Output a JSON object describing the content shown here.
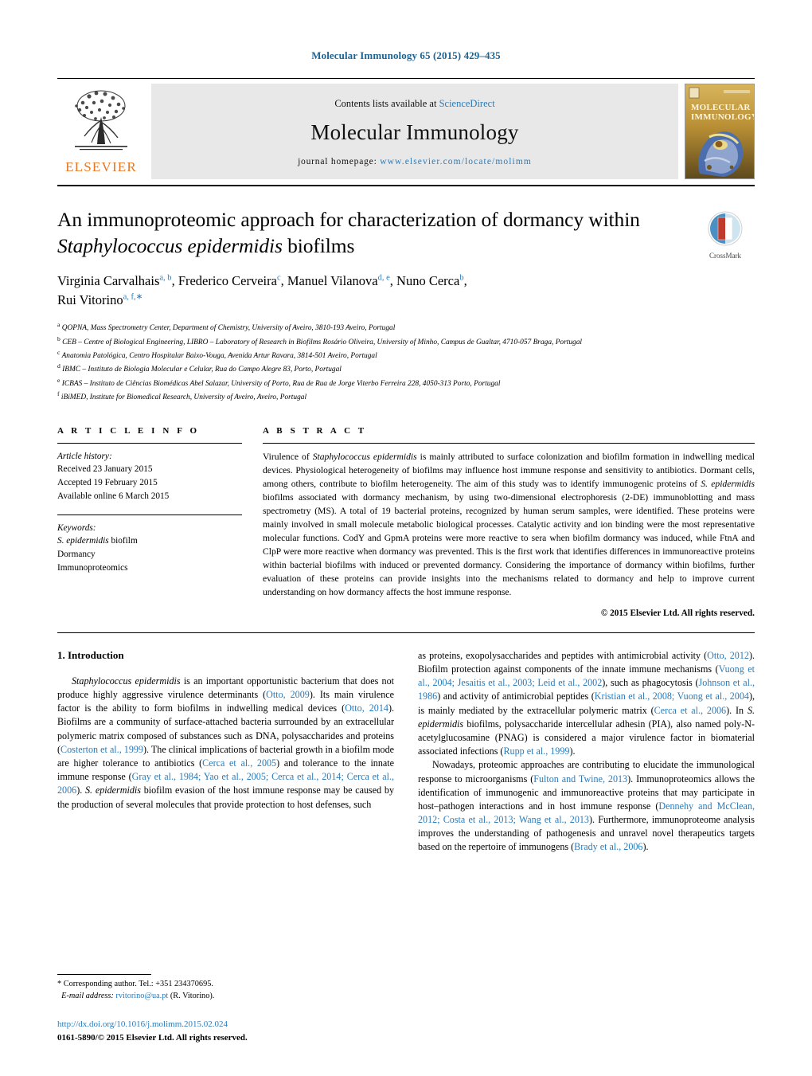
{
  "running_head": "Molecular Immunology 65 (2015) 429–435",
  "masthead": {
    "publisher": "ELSEVIER",
    "contents_prefix": "Contents lists available at ",
    "contents_link": "ScienceDirect",
    "journal_name": "Molecular Immunology",
    "homepage_prefix": "journal homepage: ",
    "homepage_url": "www.elsevier.com/locate/molimm",
    "cover_line1": "MOLECULAR",
    "cover_line2": "IMMUNOLOGY"
  },
  "article": {
    "title_part1": "An immunoproteomic approach for characterization of dormancy within ",
    "title_italic": "Staphylococcus epidermidis",
    "title_part2": " biofilms",
    "crossmark_label": "CrossMark",
    "authors": [
      {
        "name": "Virginia Carvalhais",
        "sup": "a, b",
        "sep": ", "
      },
      {
        "name": "Frederico Cerveira",
        "sup": "c",
        "sep": ", "
      },
      {
        "name": "Manuel Vilanova",
        "sup": "d, e",
        "sep": ", "
      },
      {
        "name": "Nuno Cerca",
        "sup": "b",
        "sep": ", "
      },
      {
        "name": "Rui Vitorino",
        "sup": "a, f,",
        "sep": ""
      }
    ],
    "affiliations": [
      {
        "mark": "a",
        "text": "QOPNA, Mass Spectrometry Center, Department of Chemistry, University of Aveiro, 3810-193 Aveiro, Portugal"
      },
      {
        "mark": "b",
        "text": "CEB – Centre of Biological Engineering, LIBRO – Laboratory of Research in Biofilms Rosário Oliveira, University of Minho, Campus de Gualtar, 4710-057 Braga, Portugal"
      },
      {
        "mark": "c",
        "text": "Anatomia Patológica, Centro Hospitalar Baixo-Vouga, Avenida Artur Ravara, 3814-501 Aveiro, Portugal"
      },
      {
        "mark": "d",
        "text": "IBMC – Instituto de Biologia Molecular e Celular, Rua do Campo Alegre 83, Porto, Portugal"
      },
      {
        "mark": "e",
        "text": "ICBAS – Instituto de Ciências Biomédicas Abel Salazar, University of Porto, Rua de Rua de Jorge Viterbo Ferreira 228, 4050-313 Porto, Portugal"
      },
      {
        "mark": "f",
        "text": "iBiMED, Institute for Biomedical Research, University of Aveiro, Aveiro, Portugal"
      }
    ]
  },
  "article_info": {
    "heading": "A R T I C L E   I N F O",
    "history_label": "Article history:",
    "received": "Received 23 January 2015",
    "accepted": "Accepted 19 February 2015",
    "available": "Available online 6 March 2015",
    "keywords_label": "Keywords:",
    "keywords": [
      "S. epidermidis biofilm",
      "Dormancy",
      "Immunoproteomics"
    ]
  },
  "abstract": {
    "heading": "A B S T R A C T",
    "p1_a": "Virulence of ",
    "p1_italic": "Staphylococcus epidermidis",
    "p1_b": " is mainly attributed to surface colonization and biofilm formation in indwelling medical devices. Physiological heterogeneity of biofilms may influence host immune response and sensitivity to antibiotics. Dormant cells, among others, contribute to biofilm heterogeneity. The aim of this study was to identify immunogenic proteins of ",
    "p1_italic2": "S. epidermidis",
    "p1_c": " biofilms associated with dormancy mechanism, by using two-dimensional electrophoresis (2-DE) immunoblotting and mass spectrometry (MS). A total of 19 bacterial proteins, recognized by human serum samples, were identified. These proteins were mainly involved in small molecule metabolic biological processes. Catalytic activity and ion binding were the most representative molecular functions. CodY and GpmA proteins were more reactive to sera when biofilm dormancy was induced, while FtnA and ClpP were more reactive when dormancy was prevented. This is the first work that identifies differences in immunoreactive proteins within bacterial biofilms with induced or prevented dormancy. Considering the importance of dormancy within biofilms, further evaluation of these proteins can provide insights into the mechanisms related to dormancy and help to improve current understanding on how dormancy affects the host immune response.",
    "copyright": "© 2015 Elsevier Ltd. All rights reserved."
  },
  "introduction": {
    "heading": "1.  Introduction",
    "left_p1": {
      "italic_lead": "Staphylococcus epidermidis",
      "t1": " is an important opportunistic bacterium that does not produce highly aggressive virulence determinants (",
      "r1": "Otto, 2009",
      "t2": "). Its main virulence factor is the ability to form biofilms in indwelling medical devices (",
      "r2": "Otto, 2014",
      "t3": "). Biofilms are a community of surface-attached bacteria surrounded by an extracellular polymeric matrix composed of substances such as DNA, polysaccharides and proteins (",
      "r3": "Costerton et al., 1999",
      "t4": "). The clinical implications of bacterial growth in a biofilm mode are higher tolerance to antibiotics (",
      "r4": "Cerca et al., 2005",
      "t5": ") and tolerance to the innate immune response (",
      "r5": "Gray et al., 1984; Yao et al., 2005; Cerca et al., 2014; Cerca et al., 2006",
      "t6": "). ",
      "i2": "S. epidermidis",
      "t7": " biofilm evasion of the host immune response may be caused by the production of several molecules that provide protection to host defenses, such"
    },
    "right_p1": {
      "t1": "as proteins, exopolysaccharides and peptides with antimicrobial activity (",
      "r1": "Otto, 2012",
      "t2": "). Biofilm protection against components of the innate immune mechanisms (",
      "r2": "Vuong et al., 2004; Jesaitis et al., 2003; Leid et al., 2002",
      "t3": "), such as phagocytosis (",
      "r3": "Johnson et al., 1986",
      "t4": ") and activity of antimicrobial peptides (",
      "r4": "Kristian et al., 2008; Vuong et al., 2004",
      "t5": "), is mainly mediated by the extracellular polymeric matrix (",
      "r5": "Cerca et al., 2006",
      "t6": "). In ",
      "i1": "S. epidermidis",
      "t7": " biofilms, polysaccharide intercellular adhesin (PIA), also named poly-N-acetylglucosamine (PNAG) is considered a major virulence factor in biomaterial associated infections (",
      "r6": "Rupp et al., 1999",
      "t8": ")."
    },
    "right_p2": {
      "t1": "Nowadays, proteomic approaches are contributing to elucidate the immunological response to microorganisms (",
      "r1": "Fulton and Twine, 2013",
      "t2": "). Immunoproteomics allows the identification of immunogenic and immunoreactive proteins that may participate in host–pathogen interactions and in host immune response (",
      "r2": "Dennehy and McClean, 2012; Costa et al., 2013; Wang et al., 2013",
      "t3": "). Furthermore, immunoproteome analysis improves the understanding of pathogenesis and unravel novel therapeutics targets based on the repertoire of immunogens (",
      "r3": "Brady et al., 2006",
      "t4": ")."
    }
  },
  "footnotes": {
    "corresponding": "* Corresponding author. Tel.: +351 234370695.",
    "email_label": "E-mail address:",
    "email": "rvitorino@ua.pt",
    "email_suffix": " (R. Vitorino).",
    "doi": "http://dx.doi.org/10.1016/j.molimm.2015.02.024",
    "issn_line": "0161-5890/© 2015 Elsevier Ltd. All rights reserved."
  },
  "colors": {
    "link_blue": "#2b7bb9",
    "head_blue": "#1a6496",
    "elsevier_orange": "#E87722",
    "band_gray": "#e8e8e8"
  }
}
